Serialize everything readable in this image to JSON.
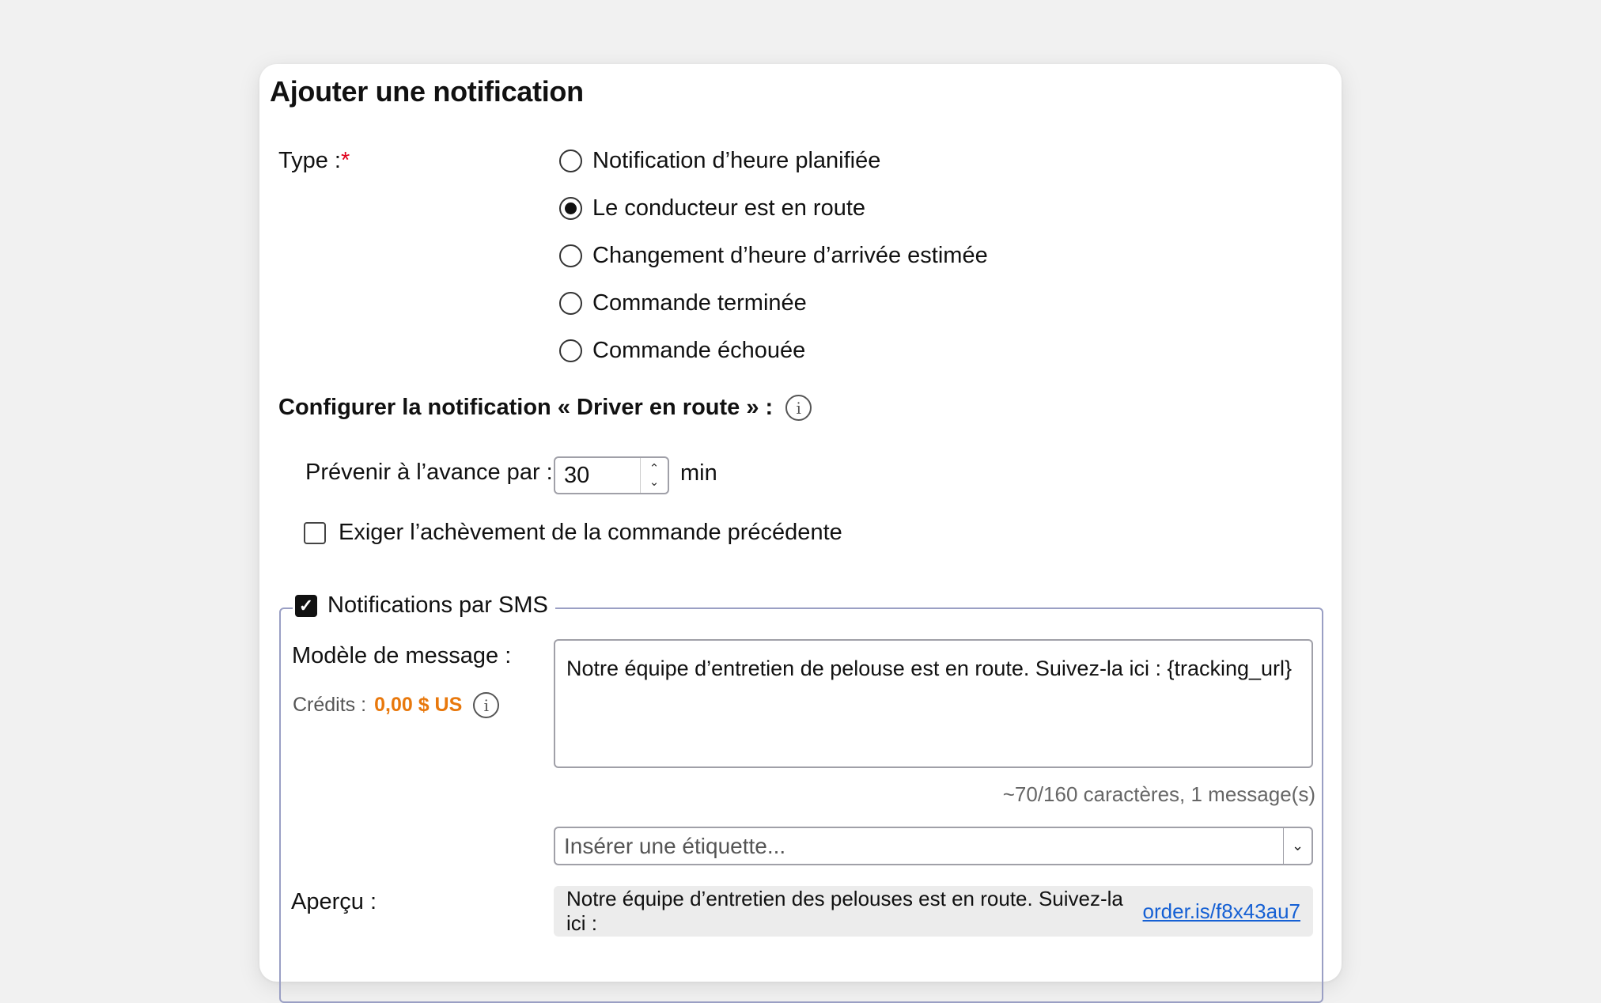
{
  "dialog": {
    "title": "Ajouter une notification"
  },
  "type": {
    "label": "Type :",
    "required_mark": "*",
    "options": [
      {
        "label": "Notification d’heure planifiée",
        "selected": false
      },
      {
        "label": "Le conducteur est en route",
        "selected": true
      },
      {
        "label": "Changement d’heure d’arrivée estimée",
        "selected": false
      },
      {
        "label": "Commande terminée",
        "selected": false
      },
      {
        "label": "Commande échouée",
        "selected": false
      }
    ]
  },
  "config": {
    "heading": "Configurer la notification « Driver en route » :",
    "advance_label": "Prévenir à l’avance par :",
    "advance_value": "30",
    "advance_unit": "min",
    "require_previous_label": "Exiger l’achèvement de la commande précédente",
    "require_previous_checked": false
  },
  "sms": {
    "legend_label": "Notifications par SMS",
    "enabled": true,
    "template_label": "Modèle de message :",
    "credits_label": "Crédits :",
    "credits_amount": "0,00 $ US",
    "template_text": "Notre équipe d’entretien de pelouse est en route. Suivez-la ici : {tracking_url}",
    "counter_text": "~70/160 caractères, 1 message(s)",
    "insert_tag_placeholder": "Insérer une étiquette...",
    "preview_label": "Aperçu :",
    "preview_text": "Notre équipe d’entretien des pelouses est en route. Suivez-la ici :",
    "preview_link": "order.is/f8x43au7"
  },
  "colors": {
    "required": "#e0001b",
    "credits": "#e8780c",
    "link": "#1560d4",
    "fieldset_border": "#9a9fc4"
  }
}
